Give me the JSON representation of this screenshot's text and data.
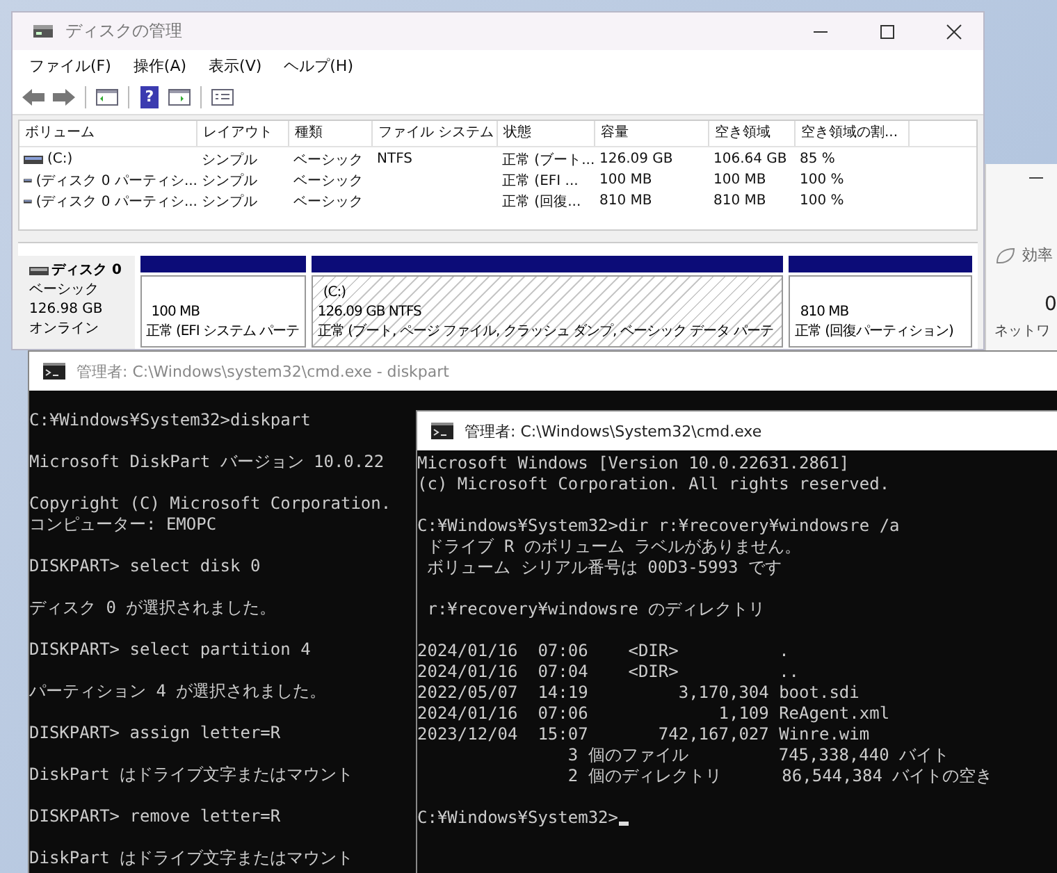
{
  "disk_management": {
    "title": "ディスクの管理",
    "menu": [
      "ファイル(F)",
      "操作(A)",
      "表示(V)",
      "ヘルプ(H)"
    ],
    "help_button": "?",
    "columns": [
      "ボリューム",
      "レイアウト",
      "種類",
      "ファイル システム",
      "状態",
      "容量",
      "空き領域",
      "空き領域の割..."
    ],
    "rows": [
      [
        "(C:)",
        "シンプル",
        "ベーシック",
        "NTFS",
        "正常 (ブート...",
        "126.09 GB",
        "106.64 GB",
        "85 %"
      ],
      [
        "(ディスク 0 パーティシ...",
        "シンプル",
        "ベーシック",
        "",
        "正常 (EFI ...",
        "100 MB",
        "100 MB",
        "100 %"
      ],
      [
        "(ディスク 0 パーティシ...",
        "シンプル",
        "ベーシック",
        "",
        "正常 (回復...",
        "810 MB",
        "810 MB",
        "100 %"
      ]
    ],
    "disk": {
      "name": "ディスク 0",
      "type": "ベーシック",
      "size": "126.98 GB",
      "status": "オンライン",
      "partitions": [
        {
          "selected": false,
          "lines": [
            "100 MB",
            "正常 (EFI システム パーテ"
          ]
        },
        {
          "selected": true,
          "lines": [
            "(C:)",
            "126.09 GB NTFS",
            "正常 (ブート, ページ ファイル, クラッシュ ダンプ, ベーシック データ パーテ"
          ]
        },
        {
          "selected": false,
          "lines": [
            "810 MB",
            "正常 (回復パーティション)"
          ]
        }
      ]
    }
  },
  "side_window": {
    "label": "効率",
    "value": "0",
    "caption": "ネットワ"
  },
  "terminals": [
    {
      "title": "管理者: C:\\Windows\\system32\\cmd.exe - diskpart",
      "active": false,
      "blocks": [
        [
          "C:¥Windows¥System32>diskpart"
        ],
        [
          "Microsoft DiskPart バージョン 10.0.22"
        ],
        [
          "Copyright (C) Microsoft Corporation.",
          "コンピューター: EMOPC"
        ],
        [
          "DISKPART> select disk 0"
        ],
        [
          "ディスク 0 が選択されました。"
        ],
        [
          "DISKPART> select partition 4"
        ],
        [
          "パーティション 4 が選択されました。"
        ],
        [
          "DISKPART> assign letter=R"
        ],
        [
          "DiskPart はドライブ文字またはマウント"
        ],
        [
          "DISKPART> remove letter=R"
        ],
        [
          "DiskPart はドライブ文字またはマウント"
        ]
      ]
    },
    {
      "title": "管理者: C:\\Windows\\System32\\cmd.exe",
      "active": true,
      "blocks": [
        [
          "Microsoft Windows [Version 10.0.22631.2861]",
          "(c) Microsoft Corporation. All rights reserved."
        ],
        [
          "C:¥Windows¥System32>dir r:¥recovery¥windowsre /a",
          " ドライブ R のボリューム ラベルがありません。",
          " ボリューム シリアル番号は 00D3-5993 です"
        ],
        [
          " r:¥recovery¥windowsre のディレクトリ"
        ],
        [
          "2024/01/16  07:06    <DIR>          .",
          "2024/01/16  07:04    <DIR>          ..",
          "2022/05/07  14:19         3,170,304 boot.sdi",
          "2024/01/16  07:06             1,109 ReAgent.xml",
          "2023/12/04  15:07       742,167,027 Winre.wim",
          "               3 個のファイル         745,338,440 バイト",
          "               2 個のディレクトリ      86,544,384 バイトの空き"
        ],
        [
          "C:¥Windows¥System32>"
        ]
      ]
    }
  ]
}
